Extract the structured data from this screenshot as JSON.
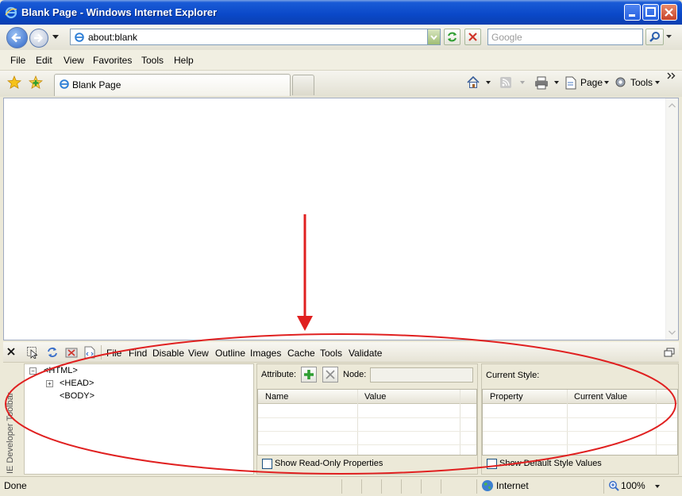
{
  "window": {
    "title": "Blank Page - Windows Internet Explorer",
    "min_label": "minimize",
    "max_label": "maximize",
    "close_label": "close"
  },
  "nav": {
    "address": "about:blank",
    "search_placeholder": "Google"
  },
  "menu": [
    "File",
    "Edit",
    "View",
    "Favorites",
    "Tools",
    "Help"
  ],
  "tabs": [
    {
      "label": "Blank Page"
    }
  ],
  "command_bar": {
    "page": "Page",
    "tools": "Tools"
  },
  "devtools": {
    "menu": [
      "File",
      "Find",
      "Disable",
      "View",
      "Outline",
      "Images",
      "Cache",
      "Tools",
      "Validate"
    ],
    "side_label": "IE Developer Toolbar",
    "tree": [
      "<HTML>",
      "<HEAD>",
      "<BODY>"
    ],
    "attr": {
      "attribute_label": "Attribute:",
      "node_label": "Node:",
      "col_name": "Name",
      "col_value": "Value",
      "show_readonly": "Show Read-Only Properties"
    },
    "style": {
      "current_style": "Current Style:",
      "col_property": "Property",
      "col_current": "Current Value",
      "show_default": "Show Default Style Values"
    }
  },
  "status": {
    "text": "Done",
    "zone": "Internet",
    "zoom": "100%"
  },
  "colors": {
    "titlebar": "#0a48c8",
    "annotation": "#e02020"
  }
}
